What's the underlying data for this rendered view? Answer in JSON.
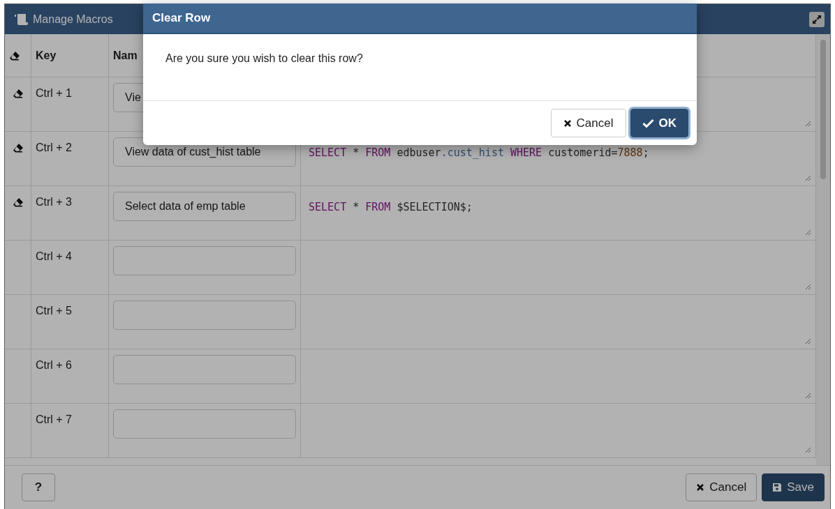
{
  "window": {
    "title": "Manage Macros"
  },
  "table": {
    "columns": [
      {
        "label": "Key"
      },
      {
        "label": "Nam"
      }
    ],
    "rows": [
      {
        "key": "Ctrl + 1",
        "clearable": true,
        "name": "Vie",
        "sql": []
      },
      {
        "key": "Ctrl + 2",
        "clearable": true,
        "name": "View data of cust_hist table",
        "sql": [
          {
            "kind": "keyword",
            "text": "SELECT"
          },
          {
            "kind": "plain",
            "text": " * "
          },
          {
            "kind": "keyword",
            "text": "FROM"
          },
          {
            "kind": "plain",
            "text": " edbuser"
          },
          {
            "kind": "property",
            "text": ".cust_hist"
          },
          {
            "kind": "keyword",
            "text": " WHERE"
          },
          {
            "kind": "plain",
            "text": " customerid="
          },
          {
            "kind": "number",
            "text": "7888"
          },
          {
            "kind": "plain",
            "text": ";"
          }
        ]
      },
      {
        "key": "Ctrl + 3",
        "clearable": true,
        "name": "Select data of emp table",
        "sql": [
          {
            "kind": "keyword",
            "text": "SELECT"
          },
          {
            "kind": "plain",
            "text": " * "
          },
          {
            "kind": "keyword",
            "text": "FROM"
          },
          {
            "kind": "plain",
            "text": " $SELECTION$;"
          }
        ]
      },
      {
        "key": "Ctrl + 4",
        "clearable": false,
        "name": "",
        "sql": []
      },
      {
        "key": "Ctrl + 5",
        "clearable": false,
        "name": "",
        "sql": []
      },
      {
        "key": "Ctrl + 6",
        "clearable": false,
        "name": "",
        "sql": []
      },
      {
        "key": "Ctrl + 7",
        "clearable": false,
        "name": "",
        "sql": []
      }
    ]
  },
  "footer": {
    "help": "?",
    "buttons": [
      {
        "kind": "cancel",
        "label": "Cancel"
      },
      {
        "kind": "save",
        "label": "Save"
      }
    ]
  },
  "dialog": {
    "title": "Clear Row",
    "message": "Are you sure you wish to clear this row?",
    "buttons": [
      {
        "kind": "cancel",
        "label": "Cancel",
        "focused": false
      },
      {
        "kind": "ok",
        "label": "OK",
        "focused": true
      }
    ]
  }
}
